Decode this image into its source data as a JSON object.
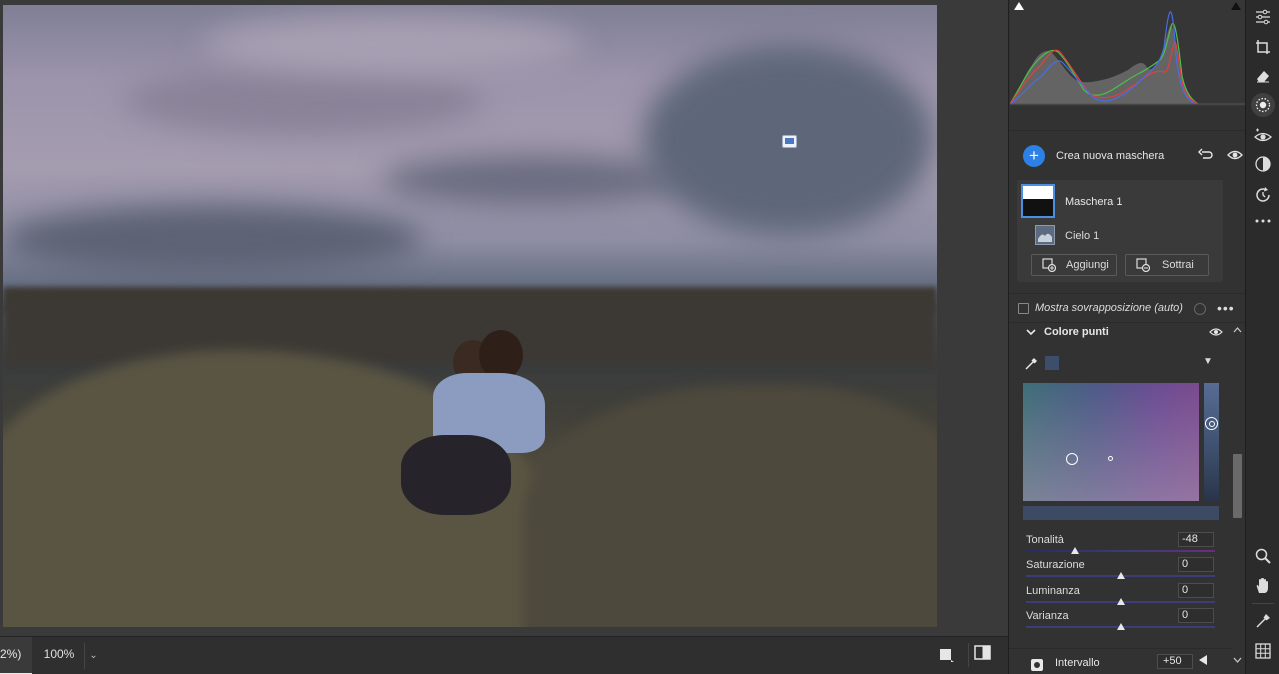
{
  "canvas": {
    "photo_alt": "Foto",
    "zoom_fit_label": "2%)",
    "zoom_level": "100%",
    "zoom_dropdown_icon": "chevron-down-icon"
  },
  "masks_panel": {
    "create_mask_label": "Crea nuova maschera",
    "mask_name": "Maschera 1",
    "component_name": "Cielo 1",
    "add_button": "Aggiungi",
    "subtract_button": "Sottrai",
    "overlay_label": "Mostra sovrapposizione (auto)",
    "overlay_checked": false
  },
  "color_range": {
    "section_title": "Colore punti",
    "selected_swatch": "#3c4e6b",
    "sliders": [
      {
        "label": "Tonalità",
        "value": "-48",
        "position": 0.26
      },
      {
        "label": "Saturazione",
        "value": "0",
        "position": 0.5
      },
      {
        "label": "Luminanza",
        "value": "0",
        "position": 0.5
      },
      {
        "label": "Varianza",
        "value": "0",
        "position": 0.5
      }
    ],
    "interval_label": "Intervallo",
    "interval_value": "+50"
  },
  "colors": {
    "accent": "#2c80e6",
    "panel_bg": "#323232",
    "histogram_red": "#e0413a",
    "histogram_green": "#4cc24a",
    "histogram_blue": "#4a6de8"
  },
  "toolstrip": {
    "tools": [
      "edit-sliders-icon",
      "crop-icon",
      "heal-eraser-icon",
      "masking-icon",
      "red-eye-icon",
      "presets-icon",
      "versions-icon",
      "more-icon"
    ],
    "bottom_tools": [
      "zoom-icon",
      "hand-icon",
      "sampler-icon",
      "grid-icon"
    ]
  }
}
